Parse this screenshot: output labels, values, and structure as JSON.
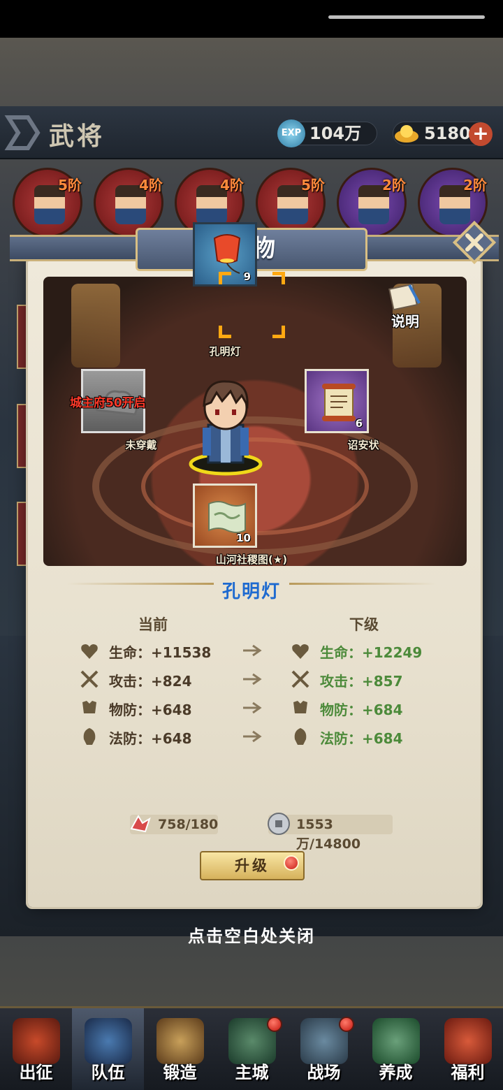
{
  "header": {
    "title": "武将",
    "exp_icon_text": "EXP",
    "exp_value": "104万",
    "gold_value": "5180"
  },
  "heroes": [
    {
      "rank": "5阶",
      "bg": "red"
    },
    {
      "rank": "4阶",
      "bg": "red"
    },
    {
      "rank": "4阶",
      "bg": "red"
    },
    {
      "rank": "5阶",
      "bg": "red"
    },
    {
      "rank": "2阶",
      "bg": "purple"
    },
    {
      "rank": "2阶",
      "bg": "purple"
    }
  ],
  "modal": {
    "title": "宝物",
    "explain_label": "说明",
    "slots": {
      "top": {
        "name": "孔明灯",
        "count": "9",
        "icon": "sky-lantern-icon"
      },
      "left": {
        "name": "未穿戴",
        "lock_text": "城主府50开启",
        "icon": "cloud-icon"
      },
      "right": {
        "name": "诏安状",
        "count": "6",
        "icon": "scroll-icon"
      },
      "bottom": {
        "name": "山河社稷图(★)",
        "count": "10",
        "icon": "map-scroll-icon"
      }
    },
    "selected_name": "孔明灯",
    "current_header": "当前",
    "next_header": "下级",
    "stats_current": [
      {
        "label": "生命：+11538",
        "icon": "heart-icon"
      },
      {
        "label": "攻击：+824",
        "icon": "crossed-swords-icon"
      },
      {
        "label": "物防：+648",
        "icon": "armor-icon"
      },
      {
        "label": "法防：+648",
        "icon": "helmet-icon"
      }
    ],
    "stats_next": [
      {
        "label": "生命：+12249",
        "icon": "heart-icon"
      },
      {
        "label": "攻击：+857",
        "icon": "crossed-swords-icon"
      },
      {
        "label": "物防：+684",
        "icon": "armor-icon"
      },
      {
        "label": "法防：+684",
        "icon": "helmet-icon"
      }
    ],
    "cost_material": "758/180",
    "cost_coins": "1553万/14800",
    "upgrade_label": "升级"
  },
  "close_hint": "点击空白处关闭",
  "nav": [
    {
      "label": "出征",
      "active": false,
      "badge": false
    },
    {
      "label": "队伍",
      "active": true,
      "badge": false
    },
    {
      "label": "锻造",
      "active": false,
      "badge": false
    },
    {
      "label": "主城",
      "active": false,
      "badge": true
    },
    {
      "label": "战场",
      "active": false,
      "badge": true
    },
    {
      "label": "养成",
      "active": false,
      "badge": false
    },
    {
      "label": "福利",
      "active": false,
      "badge": false
    }
  ],
  "colors": {
    "item_name": "#1e6ad0",
    "stat_next": "#4c8a3a",
    "lock_text": "#ff3a2a",
    "selection_corner": "#ffa812"
  }
}
